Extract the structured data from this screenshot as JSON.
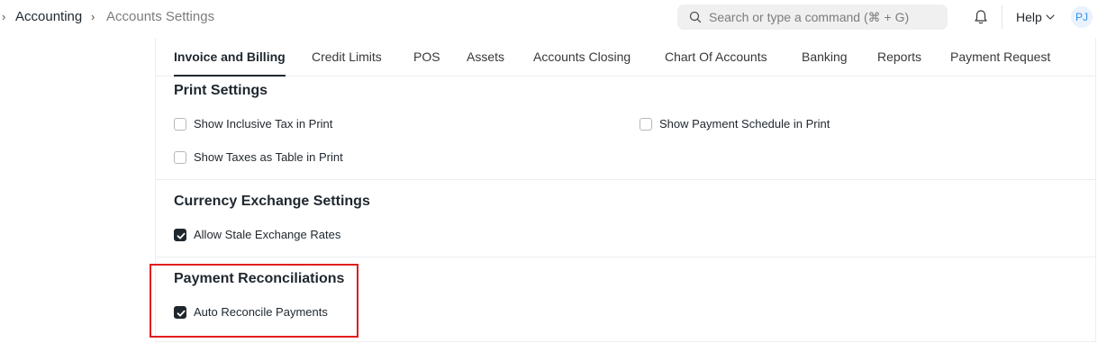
{
  "breadcrumb": {
    "separator": "›",
    "items": [
      "Accounting",
      "Accounts Settings"
    ]
  },
  "search": {
    "placeholder": "Search or type a command (⌘ + G)"
  },
  "nav": {
    "help_label": "Help",
    "avatar_initials": "PJ"
  },
  "tabs": [
    {
      "label": "Invoice and Billing",
      "active": true
    },
    {
      "label": "Credit Limits",
      "active": false
    },
    {
      "label": "POS",
      "active": false
    },
    {
      "label": "Assets",
      "active": false
    },
    {
      "label": "Accounts Closing",
      "active": false
    },
    {
      "label": "Chart Of Accounts",
      "active": false
    },
    {
      "label": "Banking",
      "active": false
    },
    {
      "label": "Reports",
      "active": false
    },
    {
      "label": "Payment Request",
      "active": false
    }
  ],
  "sections": {
    "print": {
      "title": "Print Settings",
      "options": [
        {
          "label": "Show Inclusive Tax in Print",
          "checked": false
        },
        {
          "label": "Show Payment Schedule in Print",
          "checked": false
        },
        {
          "label": "Show Taxes as Table in Print",
          "checked": false
        }
      ]
    },
    "currency": {
      "title": "Currency Exchange Settings",
      "options": [
        {
          "label": "Allow Stale Exchange Rates",
          "checked": true
        }
      ]
    },
    "reconciliation": {
      "title": "Payment Reconciliations",
      "options": [
        {
          "label": "Auto Reconcile Payments",
          "checked": true
        }
      ]
    }
  },
  "colors": {
    "highlight": "#e11d1d",
    "accent": "#1f272e"
  }
}
